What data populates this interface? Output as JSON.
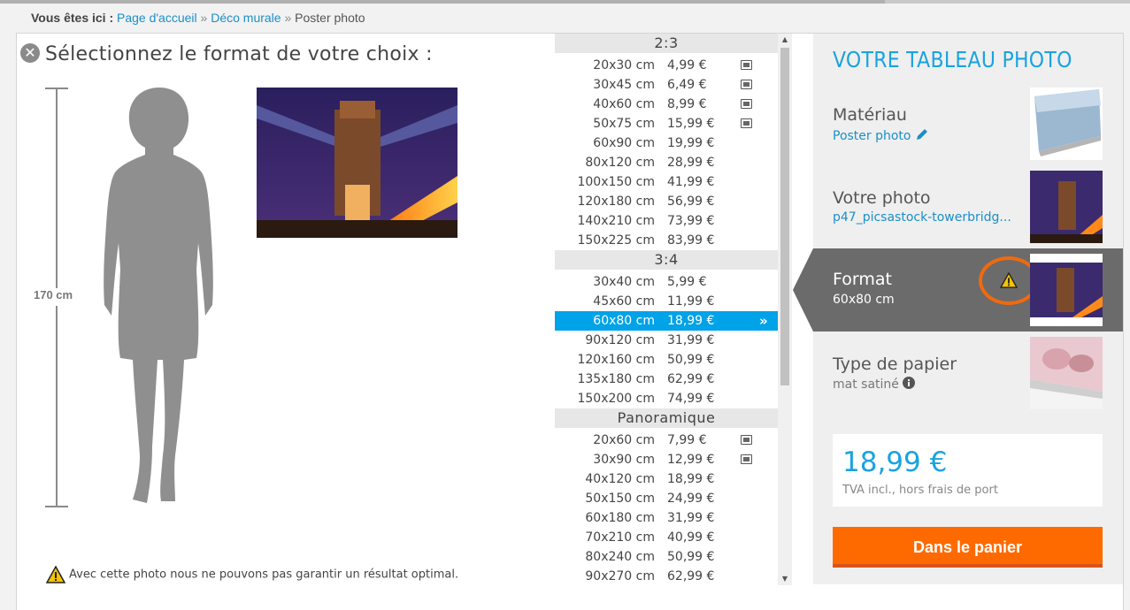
{
  "breadcrumb": {
    "lead": "Vous êtes ici :",
    "items": [
      "Page d'accueil",
      "Déco murale",
      "Poster photo"
    ],
    "separator": "»"
  },
  "left": {
    "title": "Sélectionnez le format de votre choix :",
    "scale_label": "170 cm",
    "warning_text": "Avec cette photo nous ne pouvons pas garantir un résultat optimal."
  },
  "formats": {
    "groups": [
      {
        "header": "2:3",
        "rows": [
          {
            "size": "20x30 cm",
            "price": "4,99 €",
            "img_icon": true
          },
          {
            "size": "30x45 cm",
            "price": "6,49 €",
            "img_icon": true
          },
          {
            "size": "40x60 cm",
            "price": "8,99 €",
            "img_icon": true
          },
          {
            "size": "50x75 cm",
            "price": "15,99 €",
            "img_icon": true
          },
          {
            "size": "60x90 cm",
            "price": "19,99 €"
          },
          {
            "size": "80x120 cm",
            "price": "28,99 €"
          },
          {
            "size": "100x150 cm",
            "price": "41,99 €"
          },
          {
            "size": "120x180 cm",
            "price": "56,99 €"
          },
          {
            "size": "140x210 cm",
            "price": "73,99 €"
          },
          {
            "size": "150x225 cm",
            "price": "83,99 €"
          }
        ]
      },
      {
        "header": "3:4",
        "rows": [
          {
            "size": "30x40 cm",
            "price": "5,99 €"
          },
          {
            "size": "45x60 cm",
            "price": "11,99 €"
          },
          {
            "size": "60x80 cm",
            "price": "18,99 €",
            "selected": true
          },
          {
            "size": "90x120 cm",
            "price": "31,99 €"
          },
          {
            "size": "120x160 cm",
            "price": "50,99 €"
          },
          {
            "size": "135x180 cm",
            "price": "62,99 €"
          },
          {
            "size": "150x200 cm",
            "price": "74,99 €"
          }
        ]
      },
      {
        "header": "Panoramique",
        "rows": [
          {
            "size": "20x60 cm",
            "price": "7,99 €",
            "img_icon": true
          },
          {
            "size": "30x90 cm",
            "price": "12,99 €",
            "img_icon": true
          },
          {
            "size": "40x120 cm",
            "price": "18,99 €"
          },
          {
            "size": "50x150 cm",
            "price": "24,99 €"
          },
          {
            "size": "60x180 cm",
            "price": "31,99 €"
          },
          {
            "size": "70x210 cm",
            "price": "40,99 €"
          },
          {
            "size": "80x240 cm",
            "price": "50,99 €"
          },
          {
            "size": "90x270 cm",
            "price": "62,99 €"
          }
        ]
      }
    ],
    "selected_arrow": "»"
  },
  "summary": {
    "title": "VOTRE TABLEAU PHOTO",
    "material_label": "Matériau",
    "material_value": "Poster photo",
    "photo_label": "Votre photo",
    "photo_value": "p47_picsastock-towerbridg...",
    "format_label": "Format",
    "format_value": "60x80 cm",
    "paper_label": "Type de papier",
    "paper_value": "mat satiné",
    "price": "18,99 €",
    "vat_note": "TVA incl., hors frais de port",
    "cart_button": "Dans le panier"
  },
  "colors": {
    "accent_blue": "#1aa3df",
    "selected_row": "#00a2e8",
    "cart_orange": "#ff6a00",
    "warning_ring": "#f06a0f",
    "active_step": "#6b6b6b"
  }
}
